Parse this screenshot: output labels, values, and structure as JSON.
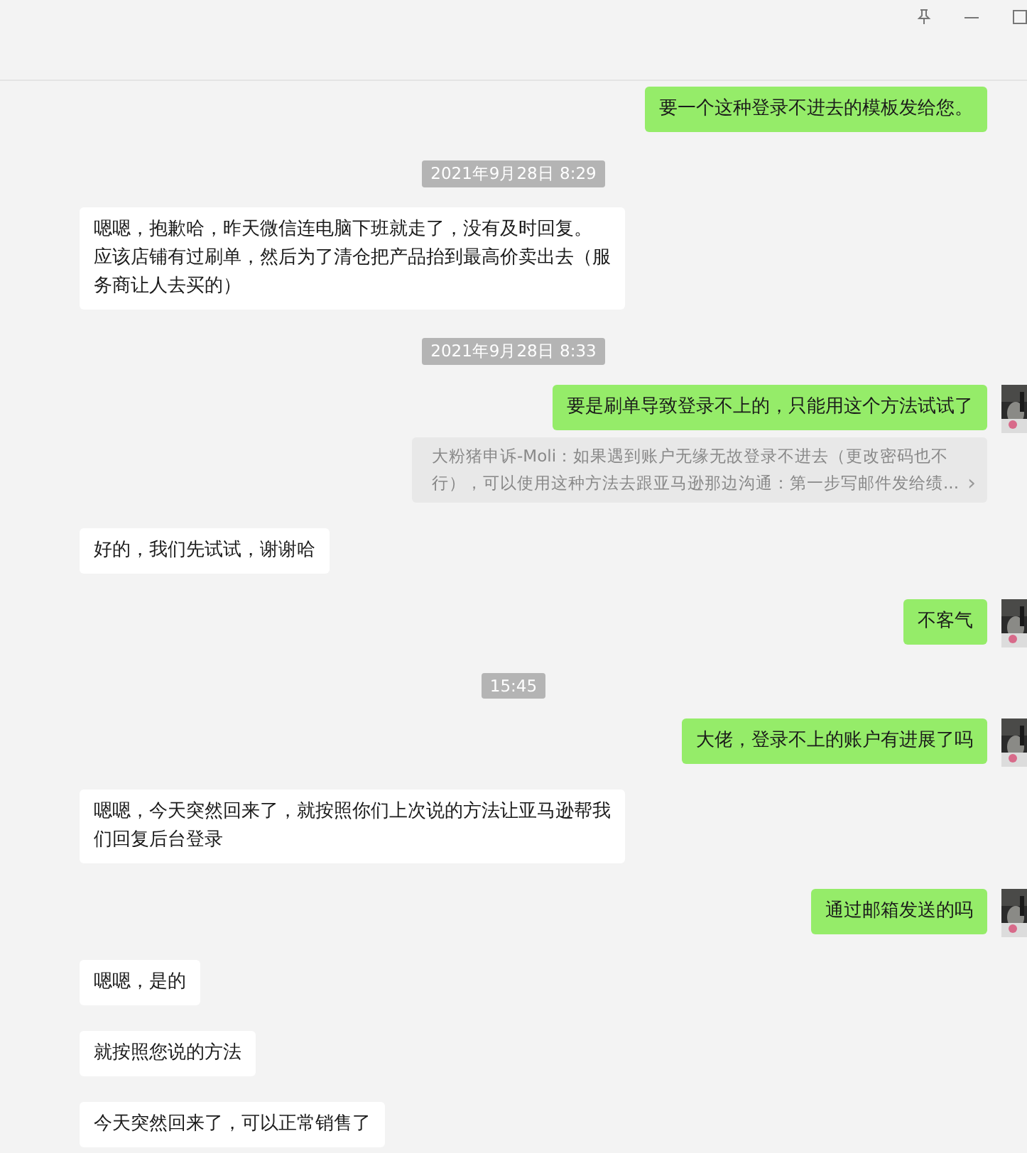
{
  "messages": [
    {
      "kind": "text",
      "outgoing": true,
      "avatar": false,
      "lines": [
        "要一个这种登录不进去的模板发给您。"
      ]
    },
    {
      "kind": "time",
      "text": "2021年9月28日 8:29"
    },
    {
      "kind": "text",
      "outgoing": false,
      "avatar": false,
      "lines": [
        "嗯嗯，抱歉哈，昨天微信连电脑下班就走了，没有及时回复。",
        "应该店铺有过刷单，然后为了清仓把产品抬到最高价卖出去（服",
        "务商让人去买的）"
      ]
    },
    {
      "kind": "time",
      "text": "2021年9月28日 8:33"
    },
    {
      "kind": "text",
      "outgoing": true,
      "avatar": true,
      "lines": [
        "要是刷单导致登录不上的，只能用这个方法试试了"
      ]
    },
    {
      "kind": "quote",
      "lines": [
        "大粉猪申诉-Moli：如果遇到账户无缘无故登录不进去（更改密码也不",
        "行），可以使用这种方法去跟亚马逊那边沟通：第一步写邮件发给绩..."
      ],
      "arrow": "›"
    },
    {
      "kind": "text",
      "outgoing": false,
      "avatar": false,
      "lines": [
        "好的，我们先试试，谢谢哈"
      ]
    },
    {
      "kind": "text",
      "outgoing": true,
      "avatar": true,
      "lines": [
        "不客气"
      ]
    },
    {
      "kind": "time",
      "text": "15:45"
    },
    {
      "kind": "text",
      "outgoing": true,
      "avatar": true,
      "lines": [
        "大佬，登录不上的账户有进展了吗"
      ]
    },
    {
      "kind": "text",
      "outgoing": false,
      "avatar": false,
      "lines": [
        "嗯嗯，今天突然回来了，就按照你们上次说的方法让亚马逊帮我",
        "们回复后台登录"
      ]
    },
    {
      "kind": "text",
      "outgoing": true,
      "avatar": true,
      "lines": [
        "通过邮箱发送的吗"
      ]
    },
    {
      "kind": "text",
      "outgoing": false,
      "avatar": false,
      "lines": [
        "嗯嗯，是的"
      ]
    },
    {
      "kind": "text",
      "outgoing": false,
      "avatar": false,
      "lines": [
        "就按照您说的方法"
      ]
    },
    {
      "kind": "text",
      "outgoing": false,
      "avatar": false,
      "lines": [
        "今天突然回来了，可以正常销售了"
      ]
    }
  ]
}
